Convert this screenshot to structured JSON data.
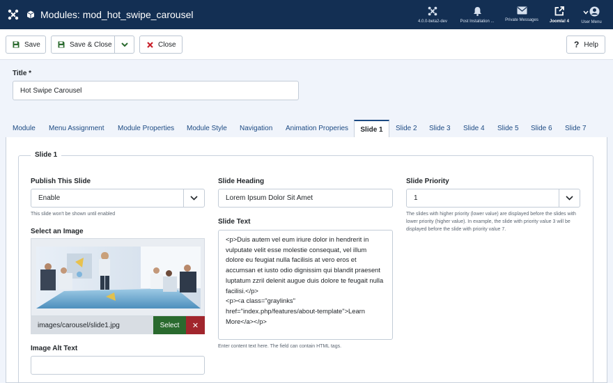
{
  "header": {
    "page_title": "Modules: mod_hot_swipe_carousel",
    "items": [
      {
        "label": "4.0.0-beta2-dev",
        "icon": "joomla-icon"
      },
      {
        "label": "Post Installation ...",
        "icon": "bell-icon"
      },
      {
        "label": "Private Messages",
        "icon": "envelope-icon"
      },
      {
        "label": "Joomla! 4",
        "icon": "external-link-icon"
      },
      {
        "label": "User Menu",
        "icon": "user-icon"
      }
    ]
  },
  "toolbar": {
    "save_label": "Save",
    "save_close_label": "Save & Close",
    "close_label": "Close",
    "help_label": "Help"
  },
  "title_field": {
    "label": "Title *",
    "value": "Hot Swipe Carousel"
  },
  "tabs": [
    {
      "label": "Module"
    },
    {
      "label": "Menu Assignment"
    },
    {
      "label": "Module Properties"
    },
    {
      "label": "Module Style"
    },
    {
      "label": "Navigation"
    },
    {
      "label": "Animation Properies"
    },
    {
      "label": "Slide 1",
      "active": true
    },
    {
      "label": "Slide 2"
    },
    {
      "label": "Slide 3"
    },
    {
      "label": "Slide 4"
    },
    {
      "label": "Slide 5"
    },
    {
      "label": "Slide 6"
    },
    {
      "label": "Slide 7"
    }
  ],
  "slide": {
    "legend": "Slide 1",
    "publish": {
      "label": "Publish This Slide",
      "value": "Enable",
      "description": "This slide won't be shown until enabled"
    },
    "image": {
      "label": "Select an Image",
      "path": "images/carousel/slide1.jpg",
      "select_label": "Select",
      "clear_label": "✕"
    },
    "alt_text": {
      "label": "Image Alt Text",
      "value": ""
    },
    "heading": {
      "label": "Slide Heading",
      "value": "Lorem Ipsum Dolor Sit Amet"
    },
    "text": {
      "label": "Slide Text",
      "value": "<p>Duis autem vel eum iriure dolor in hendrerit in vulputate velit esse molestie consequat, vel illum dolore eu feugiat nulla facilisis at vero eros et accumsan et iusto odio dignissim qui blandit praesent luptatum zzril delenit augue duis dolore te feugait nulla facilisi.</p>\n<p><a class=\"graylinks\" href=\"index.php/features/about-template\">Learn More</a></p>",
      "description": "Enter content text here. The field can contain HTML tags."
    },
    "priority": {
      "label": "Slide Priority",
      "value": "1",
      "description": "The slides with higher priority (lower value) are displayed before the slides with lower priority (higher value). In example, the slide with priority value 3 will be displayed before the slide with priority value 7."
    }
  },
  "colors": {
    "header_bg": "#132f53",
    "link": "#1c4a83",
    "save_green": "#2a6a2e",
    "danger_red": "#a1262d"
  }
}
